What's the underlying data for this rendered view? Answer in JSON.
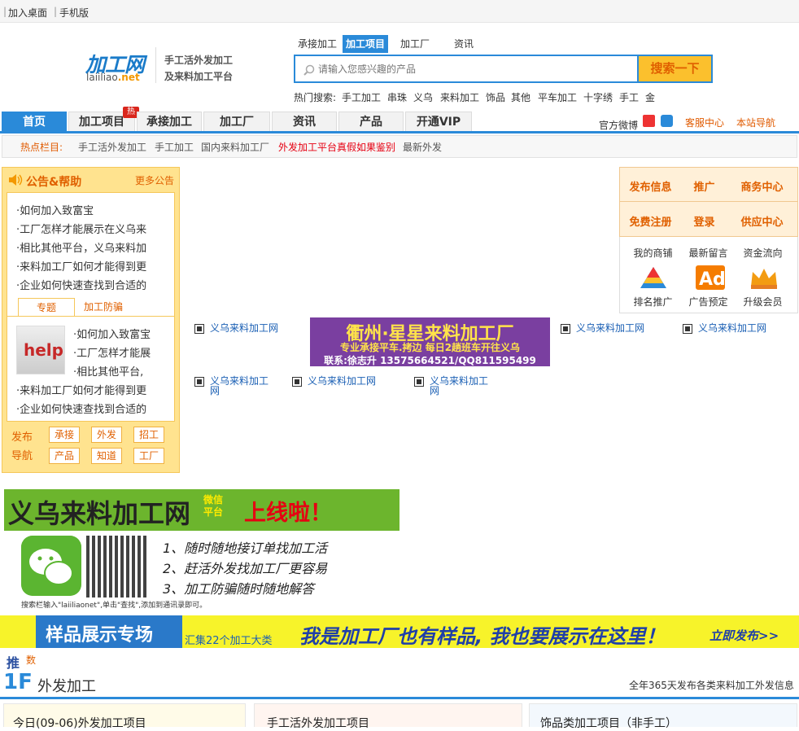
{
  "topbar": {
    "add_desktop": "加入桌面",
    "mobile": "手机版"
  },
  "logo": {
    "name": "加工网",
    "domain_prefix": "laiiliao",
    "domain_suffix": ".net",
    "slogan1": "手工活外发加工",
    "slogan2": "及来料加工平台"
  },
  "search": {
    "tabs": [
      "承接加工",
      "加工项目",
      "加工厂",
      "资讯"
    ],
    "active_tab": "加工项目",
    "placeholder": "请输入您感兴趣的产品",
    "button": "搜索一下",
    "hot_label": "热门搜索:",
    "hot_keywords": [
      "手工加工",
      "串珠",
      "义乌",
      "来料加工",
      "饰品",
      "其他",
      "平车加工",
      "十字绣",
      "手工",
      "金"
    ]
  },
  "nav": {
    "tabs": [
      "首页",
      "加工项目",
      "承接加工",
      "加工厂",
      "资讯",
      "产品",
      "开通VIP"
    ],
    "hot_badge": "热",
    "weibo": "官方微博",
    "service": "客服中心",
    "site_nav": "本站导航"
  },
  "hotbar": {
    "title": "热点栏目:",
    "links": [
      "手工活外发加工",
      "手工加工",
      "国内来料加工厂",
      "外发加工平台真假如果鉴别",
      "最新外发"
    ],
    "highlight_color": "#e60012"
  },
  "notice": {
    "title": "公告&帮助",
    "more": "更多公告",
    "items": [
      "·如何加入致富宝",
      "·工厂怎样才能展示在义乌来",
      "·相比其他平台，义乌来料加",
      "·来料加工厂如何才能得到更",
      "·企业如何快速查找到合适的"
    ],
    "tabs": [
      "专题",
      "加工防骗"
    ],
    "help_items": [
      "·如何加入致富宝",
      "·工厂怎样才能展",
      "·相比其他平台,",
      "·来料加工厂如何才能得到更",
      "·企业如何快速查找到合适的"
    ],
    "pub_nav_label": [
      "发布",
      "导航"
    ],
    "pub_buttons": [
      "承接",
      "外发",
      "招工",
      "产品",
      "知道",
      "工厂"
    ]
  },
  "right_panel": {
    "actions": [
      "发布信息",
      "推广",
      "商务中心",
      "免费注册",
      "登录",
      "供应中心"
    ],
    "icons": [
      {
        "label": "我的商铺",
        "icon": "shop-icon"
      },
      {
        "label": "最新留言",
        "icon": "message-icon"
      },
      {
        "label": "资金流向",
        "icon": "money-icon"
      },
      {
        "label": "排名推广",
        "icon": "pyramid-icon"
      },
      {
        "label": "广告预定",
        "icon": "ad-icon"
      },
      {
        "label": "升级会员",
        "icon": "crown-icon"
      }
    ]
  },
  "banner": {
    "line1": "衢州·星星来料加工厂",
    "line2": "专业承接平车.拷边 每日2趟班车开往义乌",
    "line3": "联系:徐志升 13575664521/QQ811595499"
  },
  "broken_links": [
    "义乌来料加工网",
    "义乌来料加工网",
    "义乌来料加工网",
    "义乌来料加工网",
    "义乌来料加工网",
    "义乌来料加工网"
  ],
  "wechat": {
    "title": "义乌来料加工网",
    "small1": "微信",
    "small2": "平台",
    "online": "上线啦！",
    "lines": [
      "1、随时随地接订单找加工活",
      "2、赶活外发找加工厂更容易",
      "3、加工防骗随时随地解答"
    ],
    "hint": "搜索栏输入\"laiiliaonet\",单击\"查找\",添加到通讯录即可。"
  },
  "sample": {
    "title": "样品展示专场",
    "sub": "汇集22个加工大类",
    "slogan": "我是加工厂也有样品, 我也要展示在这里！",
    "cta": "立即发布>>"
  },
  "floor": {
    "tui": "推",
    "tui2": "数",
    "num": "1F",
    "title": "外发加工",
    "desc": "全年365天发布各类来料加工外发信息",
    "cards": [
      "今日(09-06)外发加工项目",
      "手工活外发加工项目",
      "饰品类加工项目（非手工）"
    ]
  }
}
